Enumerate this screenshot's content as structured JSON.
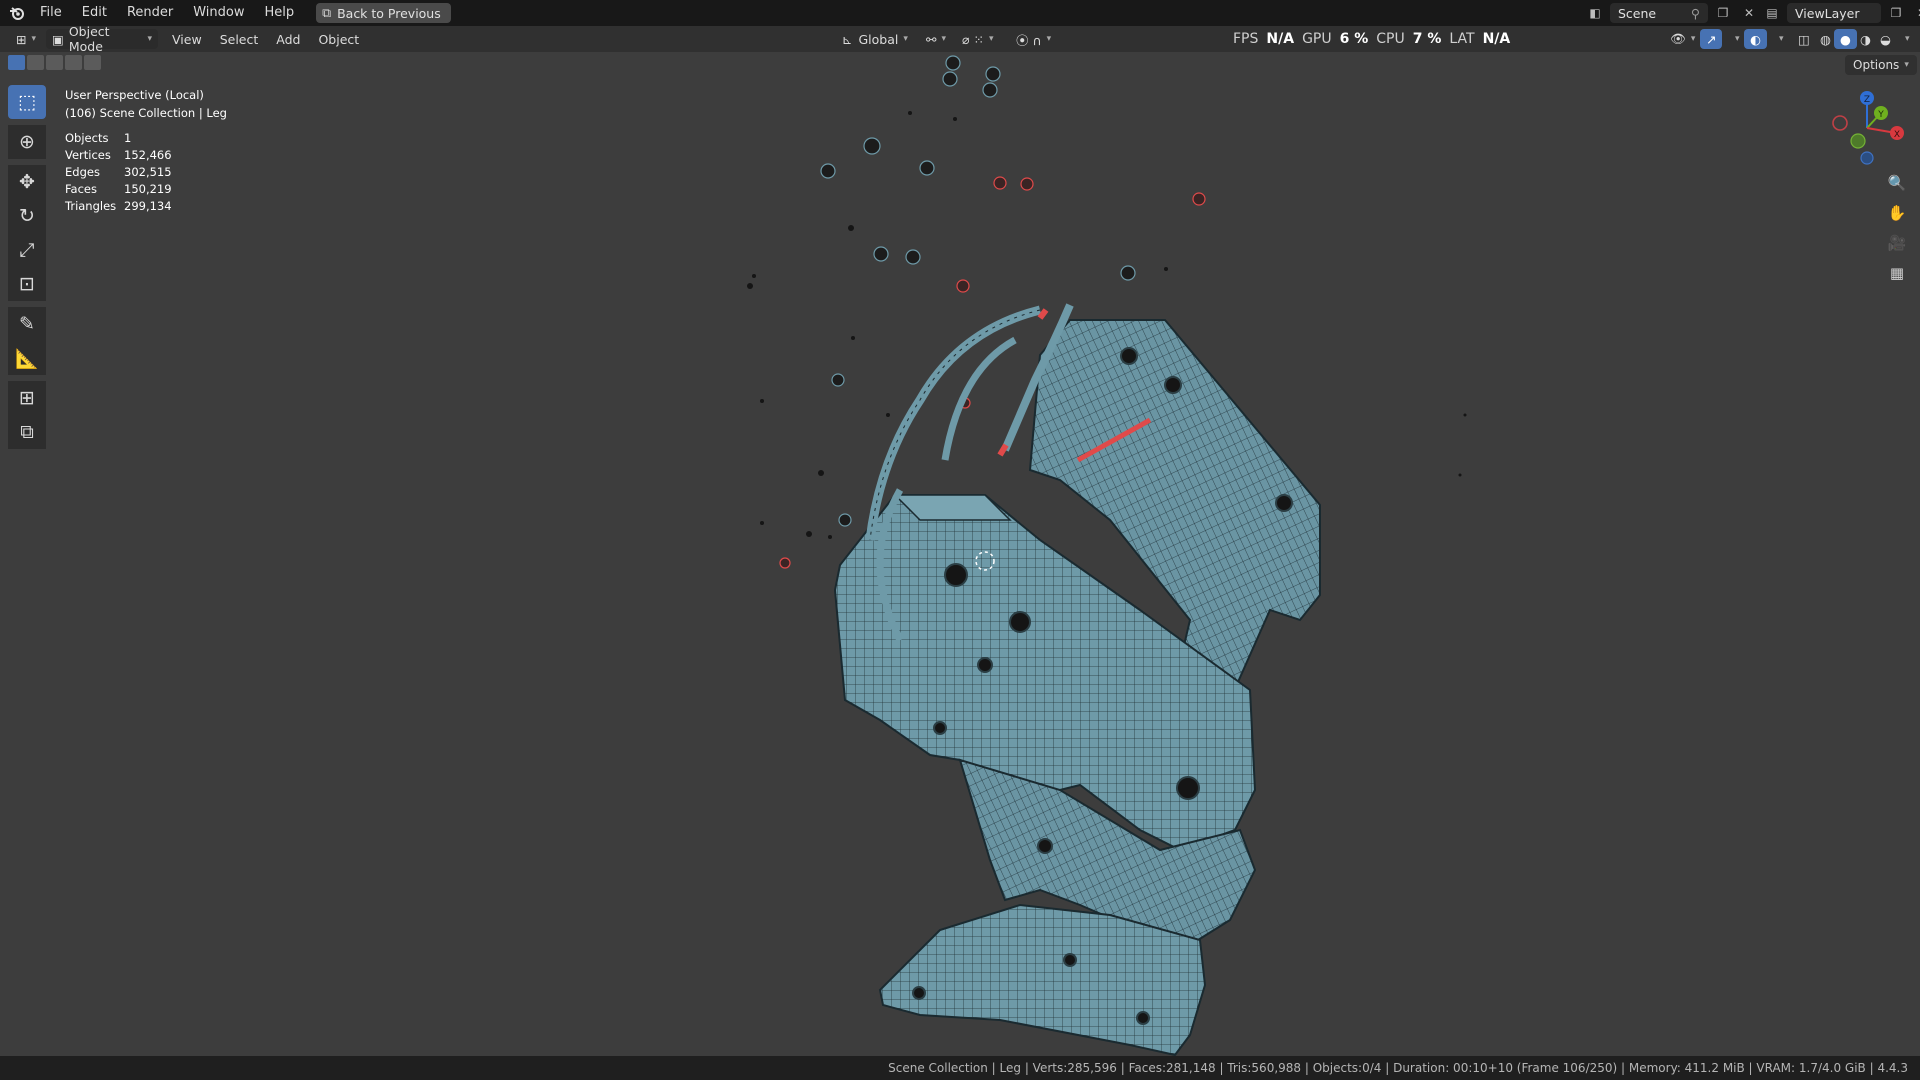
{
  "menu": {
    "items": [
      "File",
      "Edit",
      "Render",
      "Window",
      "Help"
    ],
    "back_label": "Back to Previous"
  },
  "scene_field": "Scene",
  "viewlayer_field": "ViewLayer",
  "header": {
    "mode": "Object Mode",
    "menus": [
      "View",
      "Select",
      "Add",
      "Object"
    ],
    "transform_orientation": "Global",
    "options_label": "Options"
  },
  "perf": {
    "fps_label": "FPS",
    "fps_value": "N/A",
    "gpu_label": "GPU",
    "gpu_value": "6 %",
    "cpu_label": "CPU",
    "cpu_value": "7 %",
    "lat_label": "LAT",
    "lat_value": "N/A"
  },
  "overlay": {
    "view_name": "User Perspective (Local)",
    "collection": "(106) Scene Collection | Leg",
    "stats": [
      {
        "label": "Objects",
        "value": "1"
      },
      {
        "label": "Vertices",
        "value": "152,466"
      },
      {
        "label": "Edges",
        "value": "302,515"
      },
      {
        "label": "Faces",
        "value": "150,219"
      },
      {
        "label": "Triangles",
        "value": "299,134"
      }
    ]
  },
  "gizmo": {
    "x": "X",
    "y": "Y",
    "z": "Z"
  },
  "statusbar": {
    "text": "Scene Collection | Leg | Verts:285,596 | Faces:281,148 | Tris:560,988 | Objects:0/4 | Duration: 00:10+10 (Frame 106/250) | Memory: 411.2 MiB | VRAM: 1.7/4.0 GiB | 4.4.3"
  },
  "colors": {
    "mesh": "#6e9aa8",
    "wire": "#1d2b30",
    "accent": "#4772b3",
    "selected": "#e04a4a"
  },
  "icons": [
    "blender-logo-icon",
    "back-icon",
    "scene-icon",
    "pin-icon",
    "viewlayer-icon",
    "editor-type-icon",
    "object-mode-icon",
    "global-orientation-icon",
    "pivot-icon",
    "snap-icon",
    "proportional-icon",
    "visibility-icon",
    "gizmo-icon",
    "overlay-icon",
    "xray-icon",
    "shading-wire-icon",
    "shading-solid-icon",
    "shading-material-icon",
    "shading-render-icon",
    "select-box-icon",
    "cursor-icon",
    "move-icon",
    "rotate-icon",
    "scale-icon",
    "transform-icon",
    "annotate-icon",
    "measure-icon",
    "add-cube-icon",
    "extrude-icon",
    "zoom-icon",
    "pan-icon",
    "camera-icon",
    "ortho-grid-icon"
  ]
}
